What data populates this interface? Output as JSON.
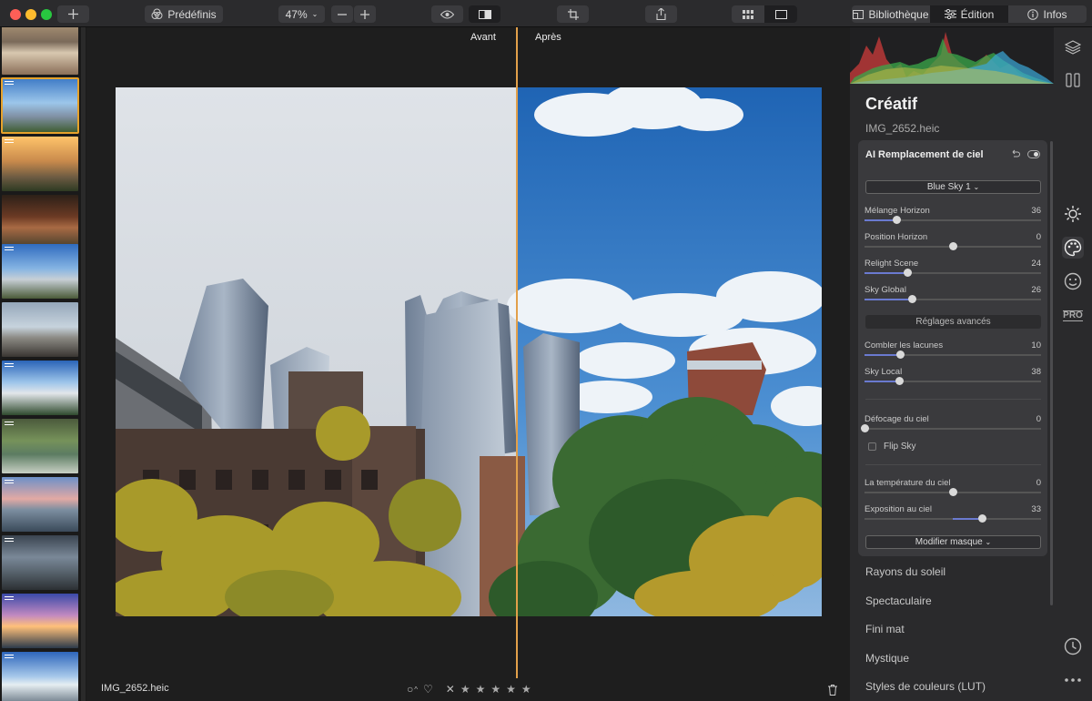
{
  "toolbar": {
    "add_icon": "plus-icon",
    "presets_label": "Prédéfinis",
    "zoom_value": "47%",
    "library_label": "Bibliothèque",
    "edit_label": "Édition",
    "info_label": "Infos"
  },
  "viewer": {
    "before_label": "Avant",
    "after_label": "Après",
    "filename": "IMG_2652.heic",
    "rating_stars": 5
  },
  "panel": {
    "title": "Créatif",
    "filename": "IMG_2652.heic",
    "tool": {
      "title": "AI Remplacement de ciel",
      "sky_preset": "Blue Sky 1",
      "sliders": {
        "melange": {
          "label": "Mélange Horizon",
          "value": "36"
        },
        "position": {
          "label": "Position Horizon",
          "value": "0"
        },
        "relight": {
          "label": "Relight Scene",
          "value": "24"
        },
        "global": {
          "label": "Sky Global",
          "value": "26"
        },
        "lacunes": {
          "label": "Combler les lacunes",
          "value": "10"
        },
        "local": {
          "label": "Sky Local",
          "value": "38"
        },
        "defocage": {
          "label": "Défocage du ciel",
          "value": "0"
        },
        "temperature": {
          "label": "La température du ciel",
          "value": "0"
        },
        "exposition": {
          "label": "Exposition au ciel",
          "value": "33"
        }
      },
      "advanced_label": "Réglages avancés",
      "flip_label": "Flip Sky",
      "mask_label": "Modifier masque"
    },
    "tools_list": [
      "Rayons du soleil",
      "Spectaculaire",
      "Fini mat",
      "Mystique",
      "Styles de couleurs (LUT)"
    ]
  },
  "colors": {
    "accent_divider": "#e2a04a",
    "slider_fill": "#6a7ad0",
    "selection": "#e6a22b"
  }
}
